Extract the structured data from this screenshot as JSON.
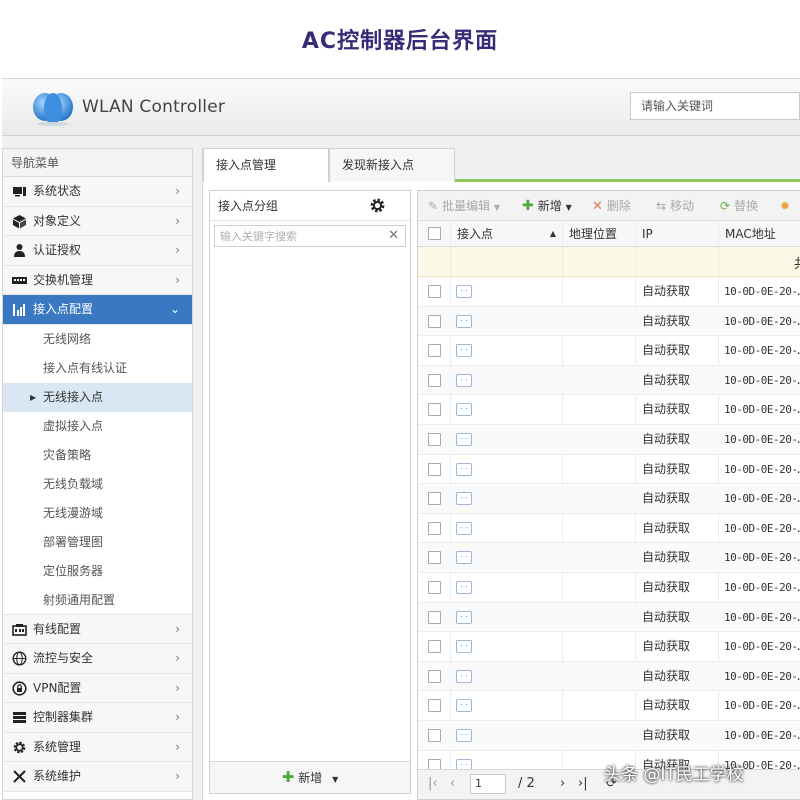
{
  "page_title": "AC控制器后台界面",
  "header": {
    "brand": "WLAN Controller",
    "search_placeholder": "请输入关键词"
  },
  "sidebar": {
    "title": "导航菜单",
    "items": [
      {
        "label": "系统状态",
        "icon": "monitor-icon"
      },
      {
        "label": "对象定义",
        "icon": "cube-icon"
      },
      {
        "label": "认证授权",
        "icon": "user-icon"
      },
      {
        "label": "交换机管理",
        "icon": "switch-icon"
      },
      {
        "label": "接入点配置",
        "icon": "signal-icon",
        "active": true
      }
    ],
    "sub_items": [
      "无线网络",
      "接入点有线认证",
      "无线接入点",
      "虚拟接入点",
      "灾备策略",
      "无线负载域",
      "无线漫游域",
      "部署管理图",
      "定位服务器",
      "射频通用配置"
    ],
    "selected_sub": "无线接入点",
    "items_after": [
      {
        "label": "有线配置",
        "icon": "wired-icon"
      },
      {
        "label": "流控与安全",
        "icon": "globe-icon"
      },
      {
        "label": "VPN配置",
        "icon": "vpn-icon"
      },
      {
        "label": "控制器集群",
        "icon": "cluster-icon"
      },
      {
        "label": "系统管理",
        "icon": "gear-icon"
      },
      {
        "label": "系统维护",
        "icon": "tools-icon"
      }
    ]
  },
  "tabs": [
    "接入点管理",
    "发现新接入点"
  ],
  "groups": {
    "title": "接入点分组",
    "search_placeholder": "输入关键字搜索",
    "add_label": "新增"
  },
  "toolbar": {
    "batch_edit": "批量编辑",
    "add": "新增",
    "delete": "删除",
    "move": "移动",
    "replace": "替换"
  },
  "table": {
    "columns": [
      "接入点",
      "地理位置",
      "IP",
      "MAC地址"
    ],
    "notice_char": "共",
    "rows": [
      {
        "ip": "自动获取",
        "mac": "10-0D-0E-20-…"
      },
      {
        "ip": "自动获取",
        "mac": "10-0D-0E-20-…"
      },
      {
        "ip": "自动获取",
        "mac": "10-0D-0E-20-…"
      },
      {
        "ip": "自动获取",
        "mac": "10-0D-0E-20-…"
      },
      {
        "ip": "自动获取",
        "mac": "10-0D-0E-20-…"
      },
      {
        "ip": "自动获取",
        "mac": "10-0D-0E-20-…"
      },
      {
        "ip": "自动获取",
        "mac": "10-0D-0E-20-…"
      },
      {
        "ip": "自动获取",
        "mac": "10-0D-0E-20-…"
      },
      {
        "ip": "自动获取",
        "mac": "10-0D-0E-20-…"
      },
      {
        "ip": "自动获取",
        "mac": "10-0D-0E-20-…"
      },
      {
        "ip": "自动获取",
        "mac": "10-0D-0E-20-…"
      },
      {
        "ip": "自动获取",
        "mac": "10-0D-0E-20-…"
      },
      {
        "ip": "自动获取",
        "mac": "10-0D-0E-20-…"
      },
      {
        "ip": "自动获取",
        "mac": "10-0D-0E-20-…"
      },
      {
        "ip": "自动获取",
        "mac": "10-0D-0E-20-…"
      },
      {
        "ip": "自动获取",
        "mac": "10-0D-0E-20-…"
      },
      {
        "ip": "自动获取",
        "mac": "10-0D-0E-20-…"
      }
    ]
  },
  "pager": {
    "current_page": "1",
    "total_pages": "/ 2"
  },
  "watermark": "头条 @IT民工学校",
  "colors": {
    "title": "#3a2a78",
    "active_nav": "#3a78c3",
    "tab_underline": "#8fc55a",
    "add_green": "#4caa3a"
  }
}
